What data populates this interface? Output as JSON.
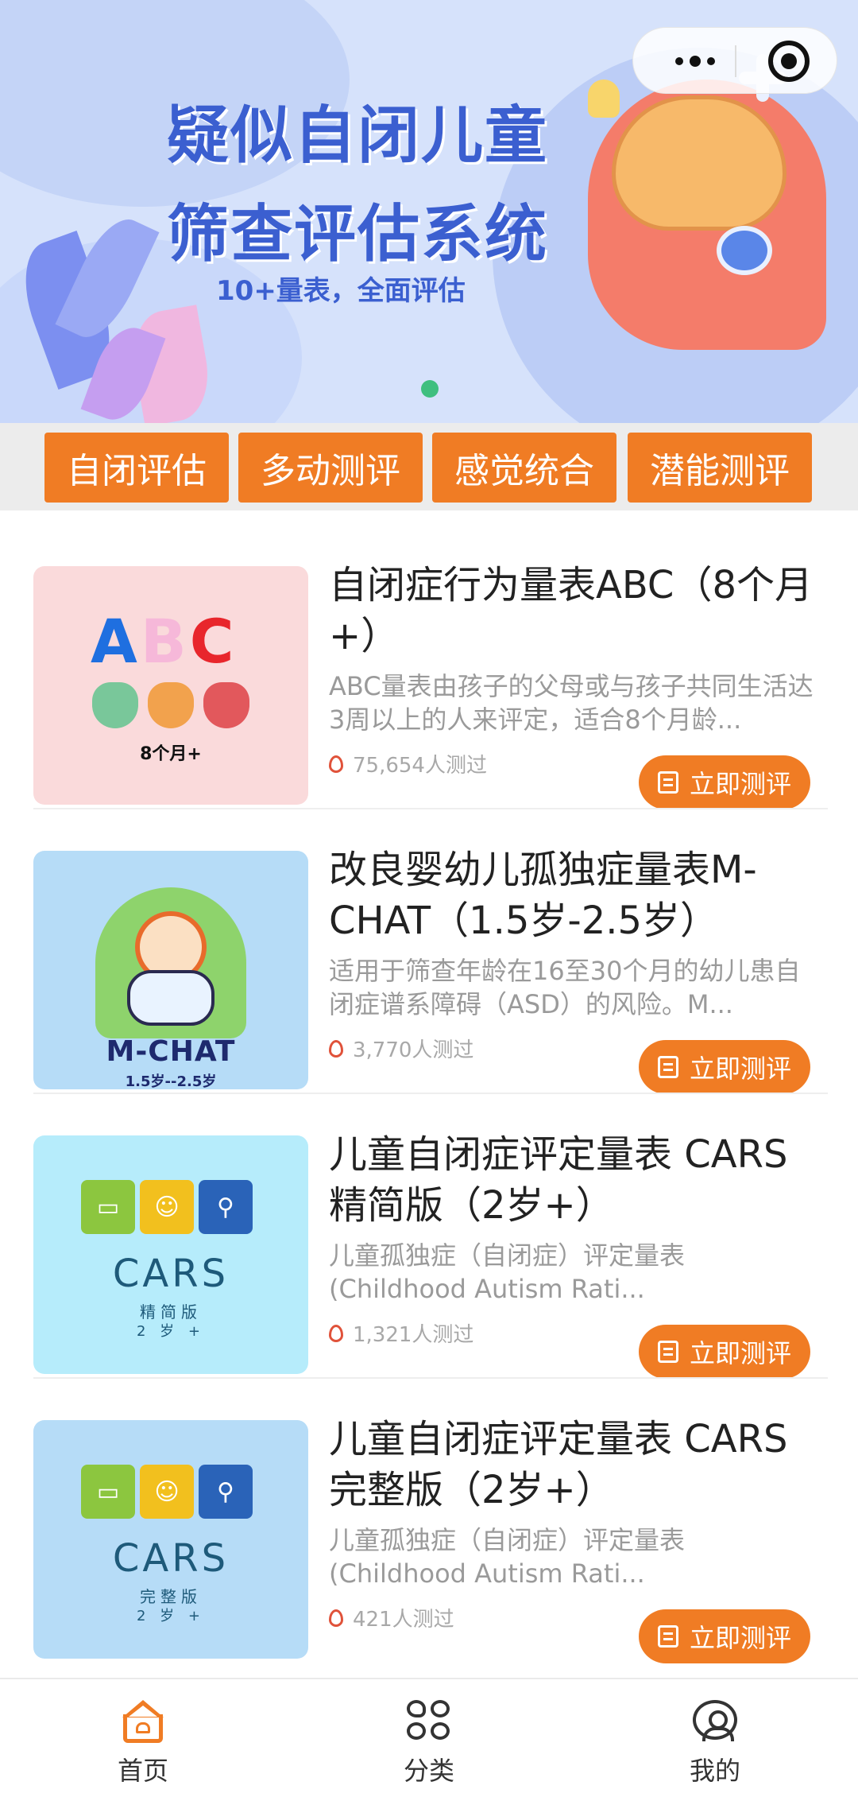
{
  "banner": {
    "title_line1": "疑似自闭儿童",
    "title_line2": "筛查评估系统",
    "subtitle": "10+量表，全面评估"
  },
  "capsule": {
    "more_icon": "more-dots-icon",
    "close_icon": "close-target-icon"
  },
  "tabs": [
    {
      "label": "自闭评估"
    },
    {
      "label": "多动测评"
    },
    {
      "label": "感觉统合"
    },
    {
      "label": "潜能测评"
    }
  ],
  "items": [
    {
      "title": "自闭症行为量表ABC（8个月+）",
      "description": "ABC量表由孩子的父母或与孩子共同生活达3周以上的人来评定，适合8个月龄...",
      "count": "75,654人测过",
      "button": "立即测评",
      "thumb": {
        "letters": "ABC",
        "age": "8个月+"
      }
    },
    {
      "title": "改良婴幼儿孤独症量表M-CHAT（1.5岁-2.5岁）",
      "description": "适用于筛查年龄在16至30个月的幼儿患自闭症谱系障碍（ASD）的风险。M...",
      "count": "3,770人测过",
      "button": "立即测评",
      "thumb": {
        "label": "M-CHAT",
        "age": "1.5岁--2.5岁"
      }
    },
    {
      "title": "儿童自闭症评定量表 CARS 精简版（2岁+）",
      "description": "儿童孤独症（自闭症）评定量表(Childhood Autism Rati...",
      "count": "1,321人测过",
      "button": "立即测评",
      "thumb": {
        "label": "CARS",
        "sub": "精简版",
        "age": "2 岁 +"
      }
    },
    {
      "title": "儿童自闭症评定量表 CARS 完整版（2岁+）",
      "description": "儿童孤独症（自闭症）评定量表(Childhood Autism Rati...",
      "count": "421人测过",
      "button": "立即测评",
      "thumb": {
        "label": "CARS",
        "sub": "完整版",
        "age": "2 岁 +"
      }
    }
  ],
  "nav": [
    {
      "label": "首页",
      "icon": "home-icon",
      "active": true
    },
    {
      "label": "分类",
      "icon": "category-icon"
    },
    {
      "label": "我的",
      "icon": "user-icon"
    }
  ],
  "colors": {
    "accent": "#f07c24",
    "banner_bg": "#d6e2fb",
    "banner_text": "#3b5fd0",
    "indicator": "#3fbf7f"
  }
}
